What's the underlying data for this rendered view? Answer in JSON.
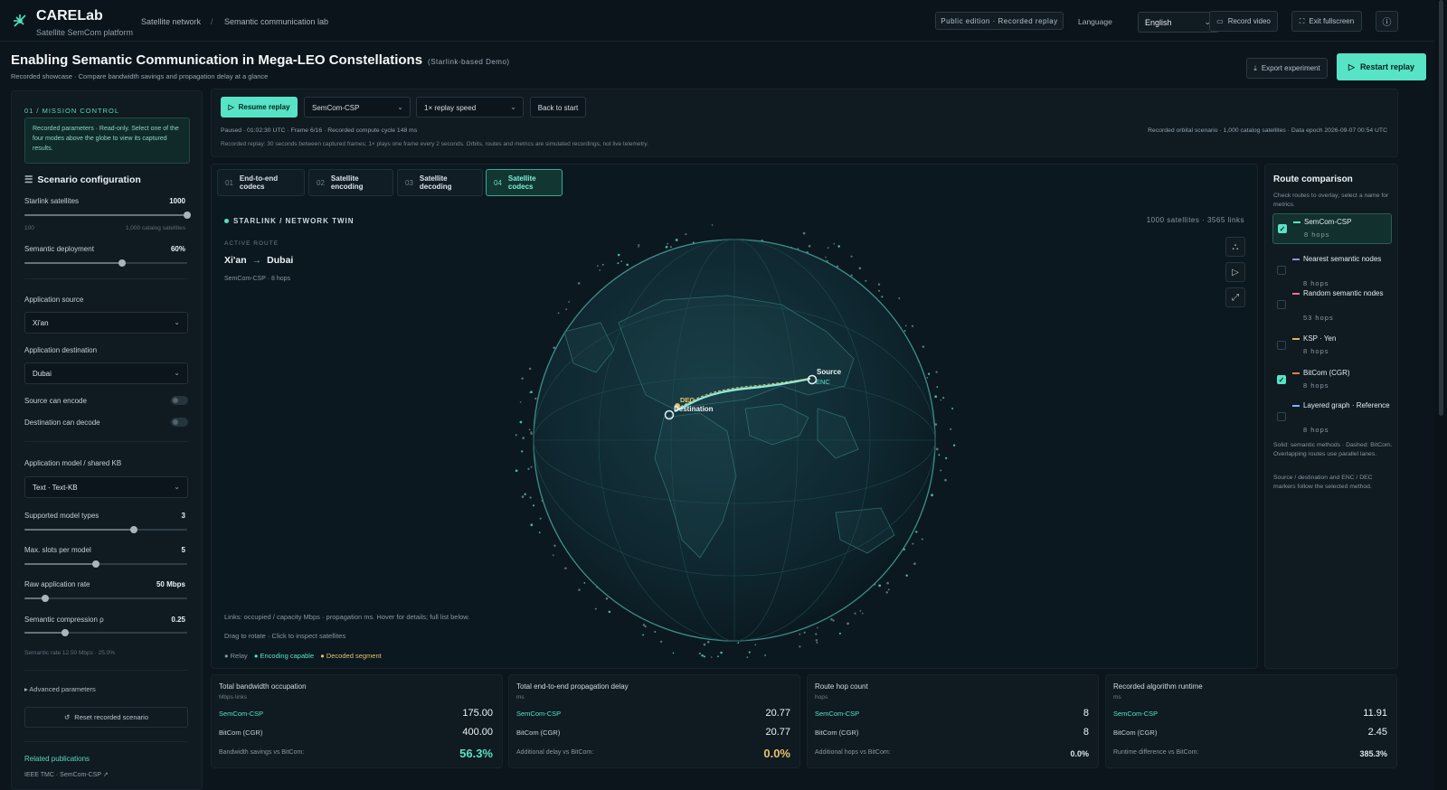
{
  "app": {
    "name": "CARELab",
    "tagline": "Satellite SemCom platform"
  },
  "breadcrumb": {
    "first": "Satellite network",
    "sep": "/",
    "second": "Semantic communication lab"
  },
  "topbar": {
    "edition": "Public edition · Recorded replay",
    "language_label": "Language",
    "language_value": "English",
    "record_video": "Record video",
    "exit_fullscreen": "Exit fullscreen",
    "info_icon": "info-icon"
  },
  "header": {
    "title": "Enabling Semantic Communication in Mega-LEO Constellations",
    "title_note": "(Starlink-based Demo)",
    "subtitle": "Recorded showcase · Compare bandwidth savings and propagation delay at a glance",
    "export": "Export experiment",
    "restart": "Restart replay"
  },
  "sidebar": {
    "mission_label": "01 / MISSION CONTROL",
    "mission_note": "Recorded parameters · Read-only. Select one of the four modes above the globe to view its captured results.",
    "scenario_title": "Scenario configuration",
    "starlink": {
      "label": "Starlink satellites",
      "value": "1000",
      "min": "100",
      "max": "1,000 catalog satellites",
      "fraction": 1.0
    },
    "semantic_deployment": {
      "label": "Semantic deployment",
      "value": "60%",
      "fraction": 0.6
    },
    "app_source": {
      "label": "Application source",
      "value": "Xi'an"
    },
    "app_destination": {
      "label": "Application destination",
      "value": "Dubai"
    },
    "source_encode": "Source can encode",
    "dest_decode": "Destination can decode",
    "app_model": {
      "label": "Application model / shared KB",
      "value": "Text · Text-KB"
    },
    "model_types": {
      "label": "Supported model types",
      "value": "3",
      "fraction": 0.67
    },
    "max_slots": {
      "label": "Max. slots per model",
      "value": "5",
      "fraction": 0.44
    },
    "raw_rate": {
      "label": "Raw application rate",
      "value": "50 Mbps",
      "fraction": 0.13
    },
    "compression": {
      "label": "Semantic compression ρ",
      "value": "0.25",
      "fraction": 0.25,
      "note": "Semantic rate 12.50 Mbps · 25.0%"
    },
    "advanced": "▸ Advanced parameters",
    "reset": "Reset recorded scenario",
    "related": "Related publications",
    "pub_link": "IEEE TMC · SemCom-CSP ↗"
  },
  "controls": {
    "resume": "Resume replay",
    "method": "SemCom-CSP",
    "speed": "1× replay speed",
    "back": "Back to start",
    "status": "Paused · 01:02:30 UTC · Frame 6/16 · Recorded compute cycle 148 ms",
    "status_note": "Recorded replay: 30 seconds between captured frames; 1× plays one frame every 2 seconds. Orbits, routes and metrics are simulated recordings, not live telemetry.",
    "scenario_info": "Recorded orbital scenario · 1,000 catalog satellites · Data epoch 2026-09-07 00:54 UTC"
  },
  "tabs": [
    {
      "num": "01",
      "label": "End-to-end codecs"
    },
    {
      "num": "02",
      "label": "Satellite encoding"
    },
    {
      "num": "03",
      "label": "Satellite decoding"
    },
    {
      "num": "04",
      "label": "Satellite codecs"
    }
  ],
  "globe": {
    "twin_label": "STARLINK / NETWORK TWIN",
    "stats": "1000 satellites · 3565 links",
    "active_route_label": "ACTIVE ROUTE",
    "route_from": "Xi'an",
    "route_arrow": "→",
    "route_to": "Dubai",
    "route_sub": "SemCom-CSP · 8 hops",
    "marker_source": "Source",
    "marker_enc": "ENC",
    "marker_dec": "DEC",
    "marker_destination": "Destination",
    "links_note": "Links: occupied / capacity Mbps · propagation ms. Hover for details; full list below.",
    "drag_note": "Drag to rotate · Click to inspect satellites",
    "legend_relay": "● Relay",
    "legend_encoding": "● Encoding capable",
    "legend_decoded": "● Decoded segment",
    "colors": {
      "accent": "#57e3c6",
      "route": "#8fe9d6",
      "decoded": "#e3c16f"
    }
  },
  "route_panel": {
    "title": "Route comparison",
    "hint": "Check routes to overlay; select a name for metrics.",
    "items": [
      {
        "name": "SemCom-CSP",
        "hops": "8 hops",
        "checked": true,
        "color": "#57e3c6"
      },
      {
        "name": "Nearest semantic nodes",
        "hops": "8 hops",
        "checked": false,
        "color": "#9b8cf0"
      },
      {
        "name": "Random semantic nodes",
        "hops": "53 hops",
        "checked": false,
        "color": "#f0728a"
      },
      {
        "name": "KSP · Yen",
        "hops": "8 hops",
        "checked": false,
        "color": "#e9b24a"
      },
      {
        "name": "BitCom (CGR)",
        "hops": "8 hops",
        "checked": true,
        "color": "#f07a57"
      },
      {
        "name": "Layered graph · Reference",
        "hops": "8 hops",
        "checked": false,
        "color": "#7fb4f0"
      }
    ],
    "note1": "Solid: semantic methods · Dashed: BitCom. Overlapping routes use parallel lanes.",
    "note2": "Source / destination and ENC / DEC markers follow the selected method."
  },
  "metrics": [
    {
      "title": "Total bandwidth occupation",
      "unit": "Mbps·links",
      "a_label": "SemCom-CSP",
      "a_val": "175.00",
      "b_label": "BitCom (CGR)",
      "b_val": "400.00",
      "diff_label": "Bandwidth savings vs BitCom:",
      "diff_val": "56.3%"
    },
    {
      "title": "Total end-to-end propagation delay",
      "unit": "ms",
      "a_label": "SemCom-CSP",
      "a_val": "20.77",
      "b_label": "BitCom (CGR)",
      "b_val": "20.77",
      "diff_label": "Additional delay vs BitCom:",
      "diff_val": "0.0%"
    },
    {
      "title": "Route hop count",
      "unit": "hops",
      "a_label": "SemCom-CSP",
      "a_val": "8",
      "b_label": "BitCom (CGR)",
      "b_val": "8",
      "diff_label": "Additional hops vs BitCom:",
      "diff_val": "0.0%"
    },
    {
      "title": "Recorded algorithm runtime",
      "unit": "ms",
      "a_label": "SemCom-CSP",
      "a_val": "11.91",
      "b_label": "BitCom (CGR)",
      "b_val": "2.45",
      "diff_label": "Runtime difference vs BitCom:",
      "diff_val": "385.3%"
    }
  ]
}
